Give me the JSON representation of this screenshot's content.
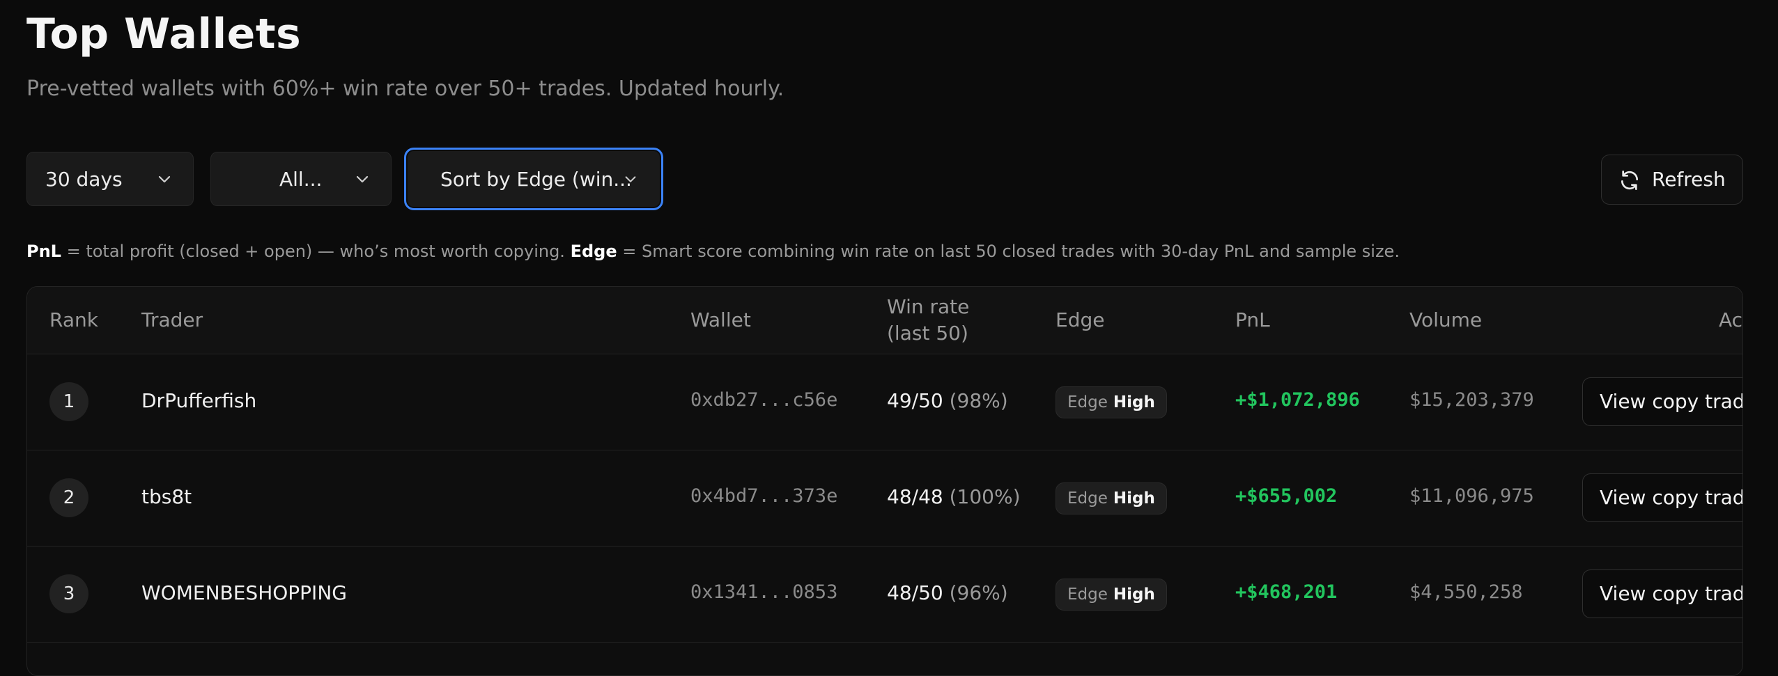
{
  "header": {
    "title": "Top Wallets",
    "subtitle": "Pre-vetted wallets with 60%+ win rate over 50+ trades. Updated hourly."
  },
  "filters": {
    "period": "30 days",
    "category": "All...",
    "sort": "Sort by Edge (win..."
  },
  "toolbar": {
    "refresh_label": "Refresh"
  },
  "legend": {
    "pnl_term": "PnL",
    "pnl_text": " = total profit (closed + open) — who’s most worth copying. ",
    "edge_term": "Edge",
    "edge_text": " = Smart score combining win rate on last 50 closed trades with 30-day PnL and sample size."
  },
  "table": {
    "headers": {
      "rank": "Rank",
      "trader": "Trader",
      "wallet": "Wallet",
      "winrate_line1": "Win rate",
      "winrate_line2": "(last 50)",
      "edge": "Edge",
      "pnl": "PnL",
      "volume": "Volume",
      "actions": "Ac"
    },
    "rows": [
      {
        "rank": "1",
        "trader": "DrPufferfish",
        "wallet": "0xdb27...c56e",
        "wins": "49/50",
        "win_pct": "(98%)",
        "edge_key": "Edge",
        "edge_value": "High",
        "pnl": "+$1,072,896",
        "volume": "$15,203,379",
        "action": "View copy trad"
      },
      {
        "rank": "2",
        "trader": "tbs8t",
        "wallet": "0x4bd7...373e",
        "wins": "48/48",
        "win_pct": "(100%)",
        "edge_key": "Edge",
        "edge_value": "High",
        "pnl": "+$655,002",
        "volume": "$11,096,975",
        "action": "View copy trad"
      },
      {
        "rank": "3",
        "trader": "WOMENBESHOPPING",
        "wallet": "0x1341...0853",
        "wins": "48/50",
        "win_pct": "(96%)",
        "edge_key": "Edge",
        "edge_value": "High",
        "pnl": "+$468,201",
        "volume": "$4,550,258",
        "action": "View copy trad"
      }
    ]
  },
  "colors": {
    "background": "#0b0b0b",
    "accent_focus": "#3b82f6",
    "pnl_positive": "#22c55e"
  },
  "icons": {
    "dropdown": "chevron-down-icon",
    "refresh": "refresh-icon"
  }
}
